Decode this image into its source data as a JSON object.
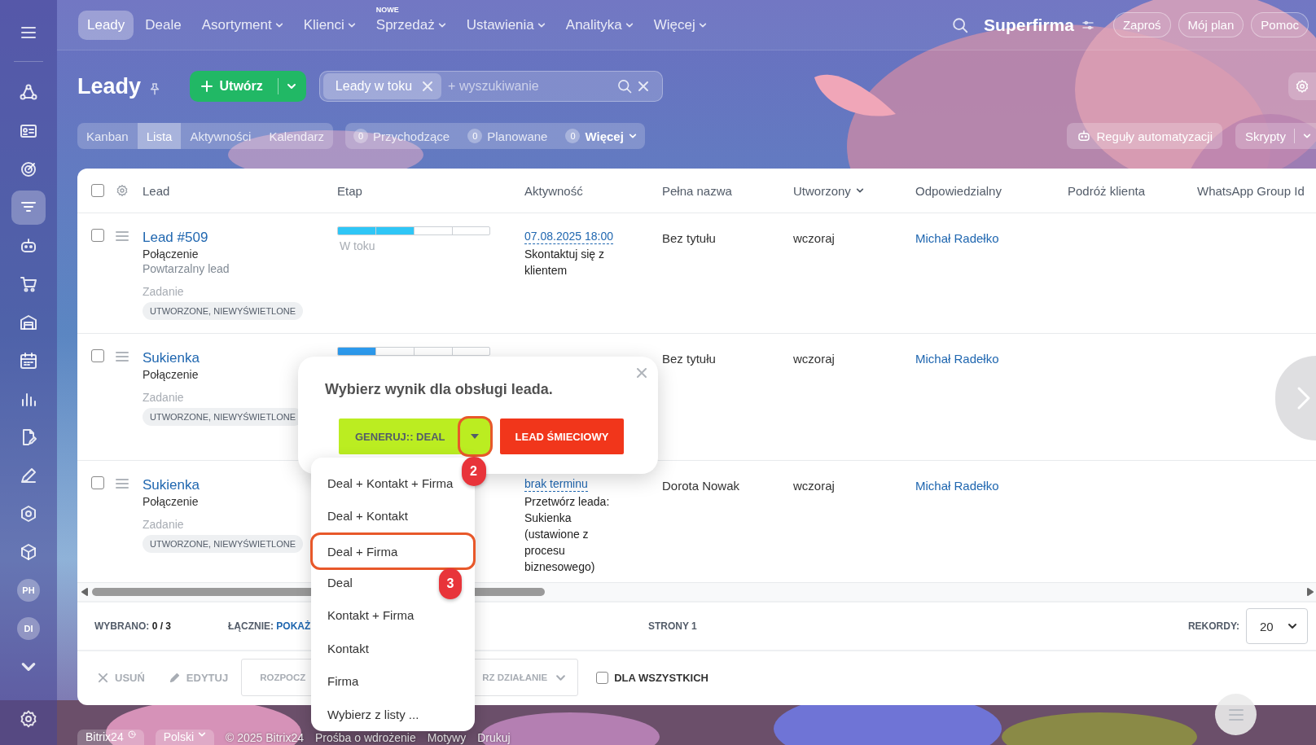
{
  "top_nav": {
    "items": [
      {
        "label": "Leady",
        "selected": true,
        "dropdown": false
      },
      {
        "label": "Deale",
        "selected": false,
        "dropdown": false
      },
      {
        "label": "Asortyment",
        "selected": false,
        "dropdown": true
      },
      {
        "label": "Klienci",
        "selected": false,
        "dropdown": true
      },
      {
        "label": "Sprzedaż",
        "selected": false,
        "dropdown": true,
        "badge": "NOWE"
      },
      {
        "label": "Ustawienia",
        "selected": false,
        "dropdown": true
      },
      {
        "label": "Analityka",
        "selected": false,
        "dropdown": true
      },
      {
        "label": "Więcej",
        "selected": false,
        "dropdown": true
      }
    ],
    "company": "Superfirma",
    "buttons": [
      "Zaproś",
      "Mój plan",
      "Pomoc"
    ]
  },
  "sidebar": {
    "items": [
      {
        "kind": "icon",
        "selected": false
      },
      {
        "kind": "icon",
        "selected": false
      },
      {
        "kind": "icon",
        "selected": false
      },
      {
        "kind": "icon",
        "selected": true
      },
      {
        "kind": "icon",
        "selected": false
      },
      {
        "kind": "icon",
        "selected": false
      },
      {
        "kind": "icon",
        "selected": false
      },
      {
        "kind": "icon",
        "selected": false
      },
      {
        "kind": "icon",
        "selected": false
      },
      {
        "kind": "icon",
        "selected": false
      },
      {
        "kind": "icon",
        "selected": false
      },
      {
        "kind": "icon",
        "selected": false
      },
      {
        "kind": "icon",
        "selected": false
      },
      {
        "kind": "avatar",
        "initials": "PH",
        "selected": false
      },
      {
        "kind": "avatar",
        "initials": "DI",
        "selected": false
      }
    ]
  },
  "header": {
    "title": "Leady",
    "create_button": "Utwórz",
    "filter": {
      "chip": "Leady w toku",
      "placeholder": "+ wyszukiwanie"
    },
    "view_tabs": [
      {
        "label": "Kanban",
        "selected": false
      },
      {
        "label": "Lista",
        "selected": true
      },
      {
        "label": "Aktywności",
        "selected": false
      },
      {
        "label": "Kalendarz",
        "selected": false
      }
    ],
    "counters": [
      {
        "count": "0",
        "label": "Przychodzące",
        "dropdown": false
      },
      {
        "count": "0",
        "label": "Planowane",
        "dropdown": false
      },
      {
        "count": "0",
        "label": "Więcej",
        "dropdown": true
      }
    ],
    "automation_button": "Reguły automatyzacji",
    "scripts_button": "Skrypty"
  },
  "table": {
    "all_checked": false,
    "columns": [
      {
        "label": "Lead",
        "sorted": false
      },
      {
        "label": "Etap",
        "sorted": false
      },
      {
        "label": "Aktywność",
        "sorted": false
      },
      {
        "label": "Pełna nazwa",
        "sorted": false
      },
      {
        "label": "Utworzony",
        "sorted": true
      },
      {
        "label": "Odpowiedzialny",
        "sorted": false
      },
      {
        "label": "Podróż klienta",
        "sorted": false
      },
      {
        "label": "WhatsApp Group Id",
        "sorted": false
      }
    ],
    "rows": [
      {
        "checked": false,
        "title": "Lead #509",
        "source": "Połączenie",
        "note": "Powtarzalny lead",
        "task_label": "Zadanie",
        "task_status": "UTWORZONE, NIEWYŚWIETLONE",
        "stage": {
          "level": 0.5,
          "color": "#2fc6f6",
          "label": "W toku"
        },
        "activity": {
          "date": "07.08.2025 18:00",
          "text": "Skontaktuj się z klientem"
        },
        "full_name": "Bez tytułu",
        "created": "wczoraj",
        "responsible": "Michał Radełko"
      },
      {
        "checked": false,
        "title": "Sukienka",
        "source": "Połączenie",
        "task_label": "Zadanie",
        "task_status": "UTWORZONE, NIEWYŚWIETLONE",
        "stage": {
          "level": 0.25,
          "color": "#2d9cf0"
        },
        "activity": {},
        "full_name": "Bez tytułu",
        "created": "wczoraj",
        "responsible": "Michał Radełko"
      },
      {
        "checked": false,
        "title": "Sukienka",
        "source": "Połączenie",
        "task_label": "Zadanie",
        "task_status": "UTWORZONE, NIEWYŚWIETLONE",
        "activity": {
          "date": "brak terminu",
          "text": "Przetwórz leada: Sukienka (ustawione z procesu biznesowego)"
        },
        "full_name": "Dorota Nowak",
        "created": "wczoraj",
        "responsible": "Michał Radełko"
      }
    ]
  },
  "list_footer": {
    "selected_label": "WYBRANO:",
    "selected_value": "0 / 3",
    "total_label": "ŁĄCZNIE:",
    "total_link": "POKAŻ",
    "pages_label": "STRONY",
    "pages_value": "1",
    "records_label": "REKORDY:",
    "records_value": "20"
  },
  "actions": {
    "delete": "USUŃ",
    "edit": "EDYTUJ",
    "action_start": "ROZPOCZ",
    "action_end": "RZ DZIAŁANIE",
    "for_all": {
      "label": "DLA WSZYSTKICH",
      "checked": false
    }
  },
  "popup": {
    "title": "Wybierz wynik dla obsługi leada.",
    "primary_button": "GENERUJ:: DEAL",
    "secondary_button": "LEAD ŚMIECIOWY",
    "split_marker": "2",
    "menu": [
      {
        "label": "Deal + Kontakt + Firma",
        "highlighted": false
      },
      {
        "label": "Deal + Kontakt",
        "highlighted": false
      },
      {
        "label": "Deal + Firma",
        "highlighted": true,
        "marker": "3"
      },
      {
        "label": "Deal",
        "highlighted": false
      },
      {
        "label": "Kontakt + Firma",
        "highlighted": false
      },
      {
        "label": "Kontakt",
        "highlighted": false
      },
      {
        "label": "Firma",
        "highlighted": false
      },
      {
        "label": "Wybierz z listy ...",
        "highlighted": false
      }
    ]
  },
  "footer": {
    "brand": "Bitrix24",
    "language": "Polski",
    "copyright": "© 2025 Bitrix24",
    "links": [
      "Prośba o wdrożenie",
      "Motywy",
      "Drukuj"
    ]
  }
}
